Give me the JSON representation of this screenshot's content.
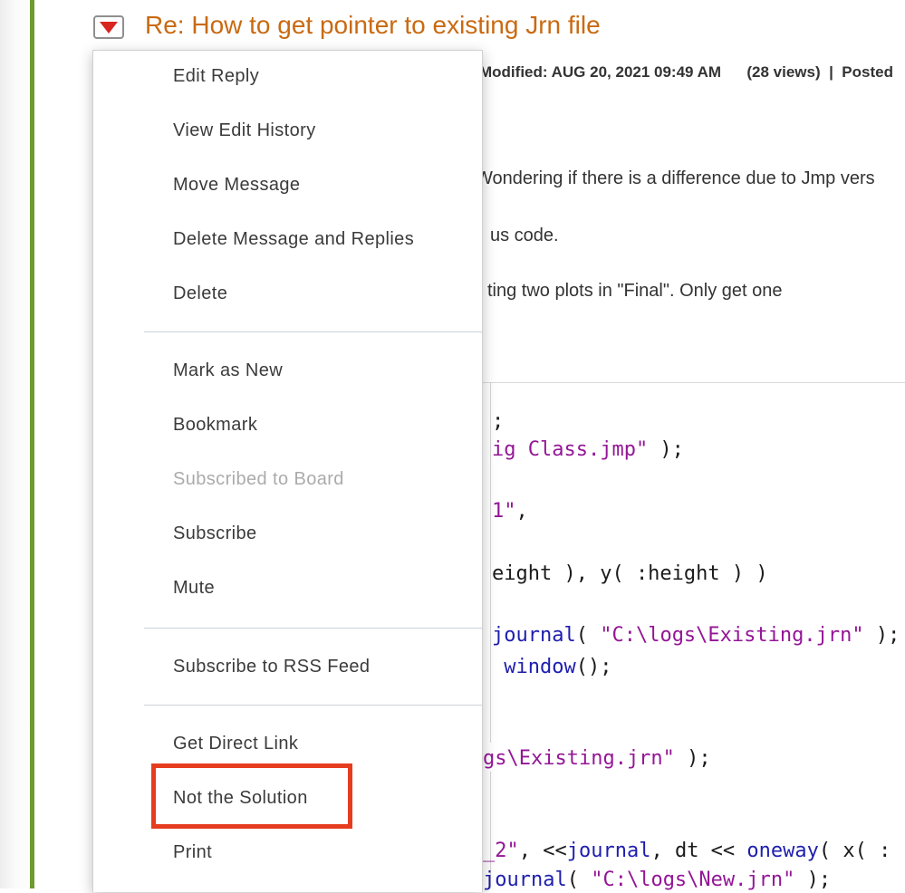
{
  "post": {
    "title": "Re: How to get pointer to existing Jrn file",
    "meta": "Modified: AUG 20, 2021 09:49 AM      (28 views)  |  Posted",
    "paragraphs": {
      "p1": "Wondering if there is a difference due to Jmp vers",
      "p2": "us code.",
      "p3": "ting two plots in \"Final\". Only get one"
    }
  },
  "icons": {
    "options_toggle": "red-triangle-icon"
  },
  "menu": {
    "items": [
      {
        "label": "Edit Reply",
        "disabled": false
      },
      {
        "label": "View Edit History",
        "disabled": false
      },
      {
        "label": "Move Message",
        "disabled": false
      },
      {
        "label": "Delete Message and Replies",
        "disabled": false
      },
      {
        "label": "Delete",
        "disabled": false
      },
      {
        "label": "Mark as New",
        "disabled": false
      },
      {
        "label": "Bookmark",
        "disabled": false
      },
      {
        "label": "Subscribed to Board",
        "disabled": true
      },
      {
        "label": "Subscribe",
        "disabled": false
      },
      {
        "label": "Mute",
        "disabled": false
      },
      {
        "label": "Subscribe to RSS Feed",
        "disabled": false
      },
      {
        "label": "Get Direct Link",
        "disabled": false
      },
      {
        "label": "Not the Solution",
        "disabled": false,
        "highlighted": true
      },
      {
        "label": "Print",
        "disabled": false
      }
    ]
  },
  "code": {
    "lines": [
      {
        "segments": [
          {
            "kind": "plain",
            "text": ";"
          }
        ]
      },
      {
        "segments": [
          {
            "kind": "str",
            "text": "ig Class.jmp\""
          },
          {
            "kind": "plain",
            "text": " );"
          }
        ]
      },
      {
        "segments": [
          {
            "kind": "str",
            "text": "1\""
          },
          {
            "kind": "plain",
            "text": ","
          }
        ]
      },
      {
        "segments": [
          {
            "kind": "plain",
            "text": "eight ), y( :height ) )"
          }
        ]
      },
      {
        "segments": [
          {
            "kind": "kw",
            "text": "journal"
          },
          {
            "kind": "plain",
            "text": "( "
          },
          {
            "kind": "str",
            "text": "\"C:\\logs\\Existing.jrn\""
          },
          {
            "kind": "plain",
            "text": " );"
          }
        ]
      },
      {
        "segments": [
          {
            "kind": "plain",
            "text": " "
          },
          {
            "kind": "kw",
            "text": "window"
          },
          {
            "kind": "plain",
            "text": "();"
          }
        ]
      },
      {
        "segments": [
          {
            "kind": "str",
            "text": "gs\\Existing.jrn\""
          },
          {
            "kind": "plain",
            "text": " );"
          }
        ]
      },
      {
        "segments": [
          {
            "kind": "str",
            "text": "_2\""
          },
          {
            "kind": "plain",
            "text": ", <<"
          },
          {
            "kind": "kw",
            "text": "journal"
          },
          {
            "kind": "plain",
            "text": ", dt << "
          },
          {
            "kind": "kw",
            "text": "oneway"
          },
          {
            "kind": "plain",
            "text": "( x( :"
          }
        ]
      },
      {
        "segments": [
          {
            "kind": "kw",
            "text": "journal"
          },
          {
            "kind": "plain",
            "text": "( "
          },
          {
            "kind": "str",
            "text": "\"C:\\logs\\New.jrn\""
          },
          {
            "kind": "plain",
            "text": " );"
          }
        ]
      }
    ]
  },
  "colors": {
    "accent_bar_green": "#6d9b2e",
    "title_orange": "#c96a12",
    "highlight_red": "#e63c1f",
    "triangle_red": "#d8251f",
    "code_keyword_blue": "#1e1eae",
    "code_string_purple": "#941696",
    "menu_text": "#3b3b3b",
    "disabled_text": "#ababab"
  }
}
